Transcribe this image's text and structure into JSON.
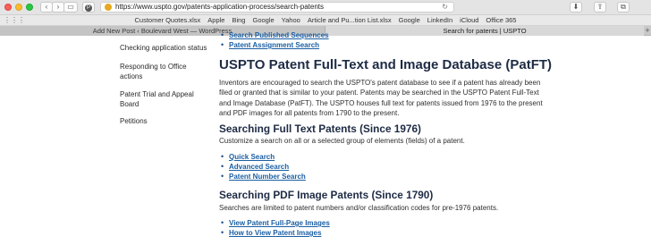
{
  "browser": {
    "url": "https://www.uspto.gov/patents-application-process/search-patents",
    "bookmarks": [
      "Customer Quotes.xlsx",
      "Apple",
      "Bing",
      "Google",
      "Yahoo",
      "Article and Pu...tion List.xlsx",
      "Google",
      "LinkedIn",
      "iCloud",
      "Office 365"
    ],
    "tabs": [
      "Add New Post ‹ Boulevard West — WordPress",
      "Search for patents | USPTO"
    ],
    "icons": {
      "back": "‹",
      "forward": "›",
      "sidebar": "▭",
      "pinterest": "P",
      "reload": "↻",
      "download": "⬇",
      "share": "⇪",
      "tabs": "⧉",
      "grid": "⋮⋮⋮",
      "new_tab": "+"
    },
    "colors": {
      "secure": "#e7a81f",
      "link": "#1b5fa3",
      "heading": "#1e2b44"
    }
  },
  "leftnav": {
    "items": [
      "Checking application status",
      "Responding to Office actions",
      "Patent Trial and Appeal Board",
      "Petitions"
    ]
  },
  "main": {
    "clipped_link": "Search Published Sequences",
    "assignment_link": "Patent Assignment Search",
    "title": "USPTO Patent Full-Text and Image Database (PatFT)",
    "intro": "Inventors are encouraged to search the USPTO's patent database to see if a patent has already been filed or granted that is similar to your patent. Patents may be searched in the USPTO Patent Full-Text and Image Database (PatFT). The USPTO houses full text for patents issued from 1976 to the present and PDF images for all patents from 1790 to the present.",
    "full_text": {
      "heading": "Searching Full Text Patents (Since 1976)",
      "description": "Customize a search on all or a selected group of elements (fields) of a patent.",
      "links": [
        "Quick Search",
        "Advanced Search",
        "Patent Number Search"
      ]
    },
    "pdf_image": {
      "heading": "Searching PDF Image Patents (Since 1790)",
      "description": "Searches are limited to patent numbers and/or classification codes for pre-1976 patents.",
      "links": [
        "View Patent Full-Page Images",
        "How to View Patent Images"
      ]
    }
  }
}
